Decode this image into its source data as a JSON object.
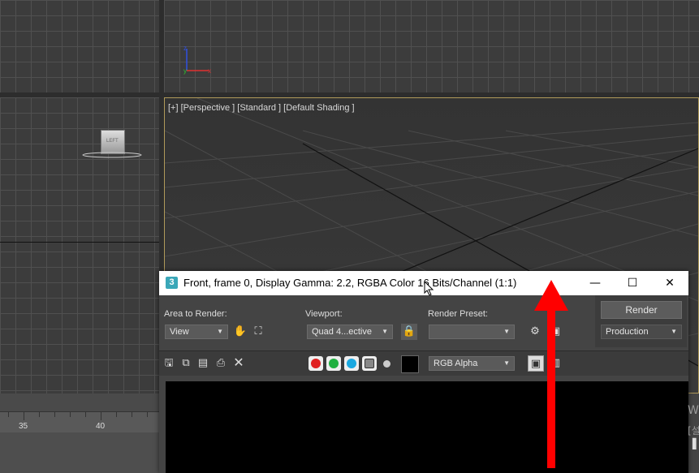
{
  "viewports": {
    "perspective_label": "[+] [Perspective ] [Standard ] [Default Shading ]",
    "left_view_cube_label": "LEFT"
  },
  "timeline": {
    "ticks": [
      "35",
      "40"
    ]
  },
  "frame_buffer": {
    "title": "Front, frame 0, Display Gamma: 2.2, RGBA Color 16 Bits/Channel (1:1)",
    "app_icon": "3",
    "window_buttons": {
      "minimize": "—",
      "maximize": "☐",
      "close": "✕"
    },
    "area_to_render": {
      "label": "Area to Render:",
      "value": "View"
    },
    "viewport": {
      "label": "Viewport:",
      "value": "Quad 4...ective"
    },
    "render_preset": {
      "label": "Render Preset:",
      "value": ""
    },
    "render_button": "Render",
    "production": "Production",
    "channel_display": "RGB Alpha",
    "channel_colors": {
      "red": "#e02020",
      "green": "#20b040",
      "blue": "#1aa8e0"
    }
  },
  "desktop_edge": {
    "text1": "W",
    "text2": "[설",
    "text3": "▌"
  },
  "annotation": {
    "arrow_color": "#ff0000"
  }
}
